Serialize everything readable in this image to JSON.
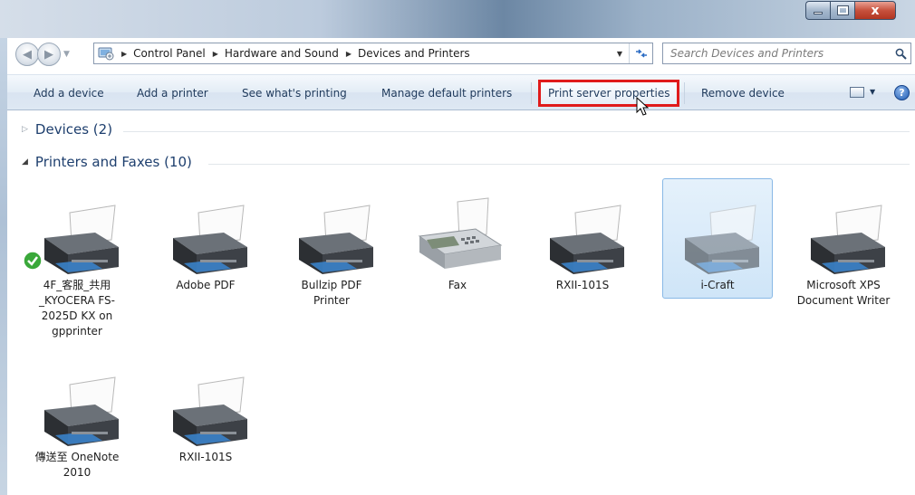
{
  "window": {
    "caption_close": "x"
  },
  "address": {
    "crumbs": [
      "Control Panel",
      "Hardware and Sound",
      "Devices and Printers"
    ]
  },
  "search": {
    "placeholder": "Search Devices and Printers"
  },
  "commandbar": {
    "add_device": "Add a device",
    "add_printer": "Add a printer",
    "see_printing": "See what's printing",
    "manage_default": "Manage default printers",
    "print_server": "Print server properties",
    "remove_device": "Remove device",
    "help": "?"
  },
  "groups": {
    "devices": "Devices (2)",
    "printers": "Printers and Faxes (10)"
  },
  "printers": [
    {
      "label": "4F_客服_共用_KYOCERA FS-2025D KX on gpprinter",
      "default": true,
      "kind": "printer"
    },
    {
      "label": "Adobe PDF",
      "kind": "printer"
    },
    {
      "label": "Bullzip PDF Printer",
      "kind": "printer"
    },
    {
      "label": "Fax",
      "kind": "fax"
    },
    {
      "label": "RXII-101S",
      "kind": "printer"
    },
    {
      "label": "i-Craft",
      "kind": "printer",
      "selected": true
    },
    {
      "label": "Microsoft XPS Document Writer",
      "kind": "printer"
    },
    {
      "label": "傳送至 OneNote 2010",
      "kind": "printer"
    },
    {
      "label": "RXII-101S",
      "kind": "printer"
    }
  ],
  "colors": {
    "highlight_box": "#e01b1b",
    "group_heading": "#1e3f6e",
    "selection": "#cfe5f8"
  }
}
